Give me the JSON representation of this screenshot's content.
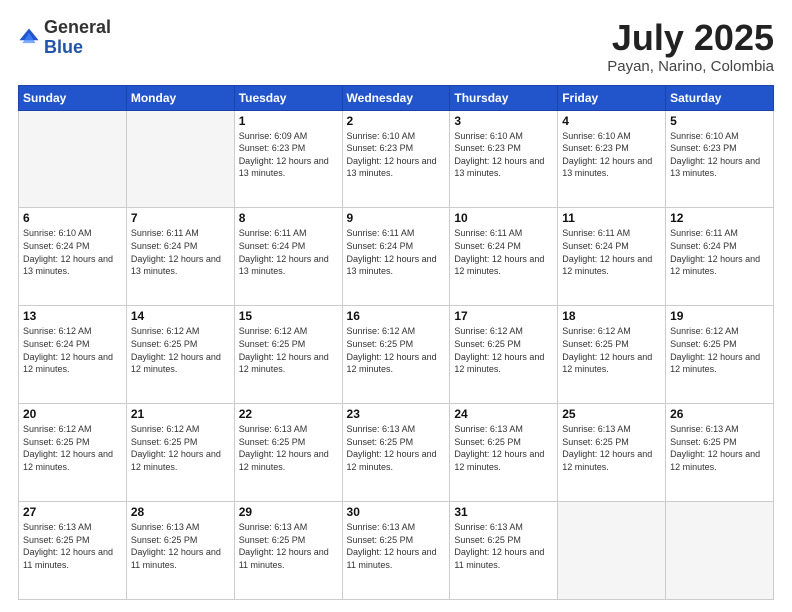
{
  "logo": {
    "general": "General",
    "blue": "Blue"
  },
  "title": "July 2025",
  "subtitle": "Payan, Narino, Colombia",
  "weekdays": [
    "Sunday",
    "Monday",
    "Tuesday",
    "Wednesday",
    "Thursday",
    "Friday",
    "Saturday"
  ],
  "weeks": [
    [
      {
        "day": null
      },
      {
        "day": null
      },
      {
        "day": "1",
        "sunrise": "6:09 AM",
        "sunset": "6:23 PM",
        "daylight": "12 hours and 13 minutes."
      },
      {
        "day": "2",
        "sunrise": "6:10 AM",
        "sunset": "6:23 PM",
        "daylight": "12 hours and 13 minutes."
      },
      {
        "day": "3",
        "sunrise": "6:10 AM",
        "sunset": "6:23 PM",
        "daylight": "12 hours and 13 minutes."
      },
      {
        "day": "4",
        "sunrise": "6:10 AM",
        "sunset": "6:23 PM",
        "daylight": "12 hours and 13 minutes."
      },
      {
        "day": "5",
        "sunrise": "6:10 AM",
        "sunset": "6:23 PM",
        "daylight": "12 hours and 13 minutes."
      }
    ],
    [
      {
        "day": "6",
        "sunrise": "6:10 AM",
        "sunset": "6:24 PM",
        "daylight": "12 hours and 13 minutes."
      },
      {
        "day": "7",
        "sunrise": "6:11 AM",
        "sunset": "6:24 PM",
        "daylight": "12 hours and 13 minutes."
      },
      {
        "day": "8",
        "sunrise": "6:11 AM",
        "sunset": "6:24 PM",
        "daylight": "12 hours and 13 minutes."
      },
      {
        "day": "9",
        "sunrise": "6:11 AM",
        "sunset": "6:24 PM",
        "daylight": "12 hours and 13 minutes."
      },
      {
        "day": "10",
        "sunrise": "6:11 AM",
        "sunset": "6:24 PM",
        "daylight": "12 hours and 12 minutes."
      },
      {
        "day": "11",
        "sunrise": "6:11 AM",
        "sunset": "6:24 PM",
        "daylight": "12 hours and 12 minutes."
      },
      {
        "day": "12",
        "sunrise": "6:11 AM",
        "sunset": "6:24 PM",
        "daylight": "12 hours and 12 minutes."
      }
    ],
    [
      {
        "day": "13",
        "sunrise": "6:12 AM",
        "sunset": "6:24 PM",
        "daylight": "12 hours and 12 minutes."
      },
      {
        "day": "14",
        "sunrise": "6:12 AM",
        "sunset": "6:25 PM",
        "daylight": "12 hours and 12 minutes."
      },
      {
        "day": "15",
        "sunrise": "6:12 AM",
        "sunset": "6:25 PM",
        "daylight": "12 hours and 12 minutes."
      },
      {
        "day": "16",
        "sunrise": "6:12 AM",
        "sunset": "6:25 PM",
        "daylight": "12 hours and 12 minutes."
      },
      {
        "day": "17",
        "sunrise": "6:12 AM",
        "sunset": "6:25 PM",
        "daylight": "12 hours and 12 minutes."
      },
      {
        "day": "18",
        "sunrise": "6:12 AM",
        "sunset": "6:25 PM",
        "daylight": "12 hours and 12 minutes."
      },
      {
        "day": "19",
        "sunrise": "6:12 AM",
        "sunset": "6:25 PM",
        "daylight": "12 hours and 12 minutes."
      }
    ],
    [
      {
        "day": "20",
        "sunrise": "6:12 AM",
        "sunset": "6:25 PM",
        "daylight": "12 hours and 12 minutes."
      },
      {
        "day": "21",
        "sunrise": "6:12 AM",
        "sunset": "6:25 PM",
        "daylight": "12 hours and 12 minutes."
      },
      {
        "day": "22",
        "sunrise": "6:13 AM",
        "sunset": "6:25 PM",
        "daylight": "12 hours and 12 minutes."
      },
      {
        "day": "23",
        "sunrise": "6:13 AM",
        "sunset": "6:25 PM",
        "daylight": "12 hours and 12 minutes."
      },
      {
        "day": "24",
        "sunrise": "6:13 AM",
        "sunset": "6:25 PM",
        "daylight": "12 hours and 12 minutes."
      },
      {
        "day": "25",
        "sunrise": "6:13 AM",
        "sunset": "6:25 PM",
        "daylight": "12 hours and 12 minutes."
      },
      {
        "day": "26",
        "sunrise": "6:13 AM",
        "sunset": "6:25 PM",
        "daylight": "12 hours and 12 minutes."
      }
    ],
    [
      {
        "day": "27",
        "sunrise": "6:13 AM",
        "sunset": "6:25 PM",
        "daylight": "12 hours and 11 minutes."
      },
      {
        "day": "28",
        "sunrise": "6:13 AM",
        "sunset": "6:25 PM",
        "daylight": "12 hours and 11 minutes."
      },
      {
        "day": "29",
        "sunrise": "6:13 AM",
        "sunset": "6:25 PM",
        "daylight": "12 hours and 11 minutes."
      },
      {
        "day": "30",
        "sunrise": "6:13 AM",
        "sunset": "6:25 PM",
        "daylight": "12 hours and 11 minutes."
      },
      {
        "day": "31",
        "sunrise": "6:13 AM",
        "sunset": "6:25 PM",
        "daylight": "12 hours and 11 minutes."
      },
      {
        "day": null
      },
      {
        "day": null
      }
    ]
  ],
  "labels": {
    "sunrise_prefix": "Sunrise: ",
    "sunset_prefix": "Sunset: ",
    "daylight_prefix": "Daylight: "
  }
}
